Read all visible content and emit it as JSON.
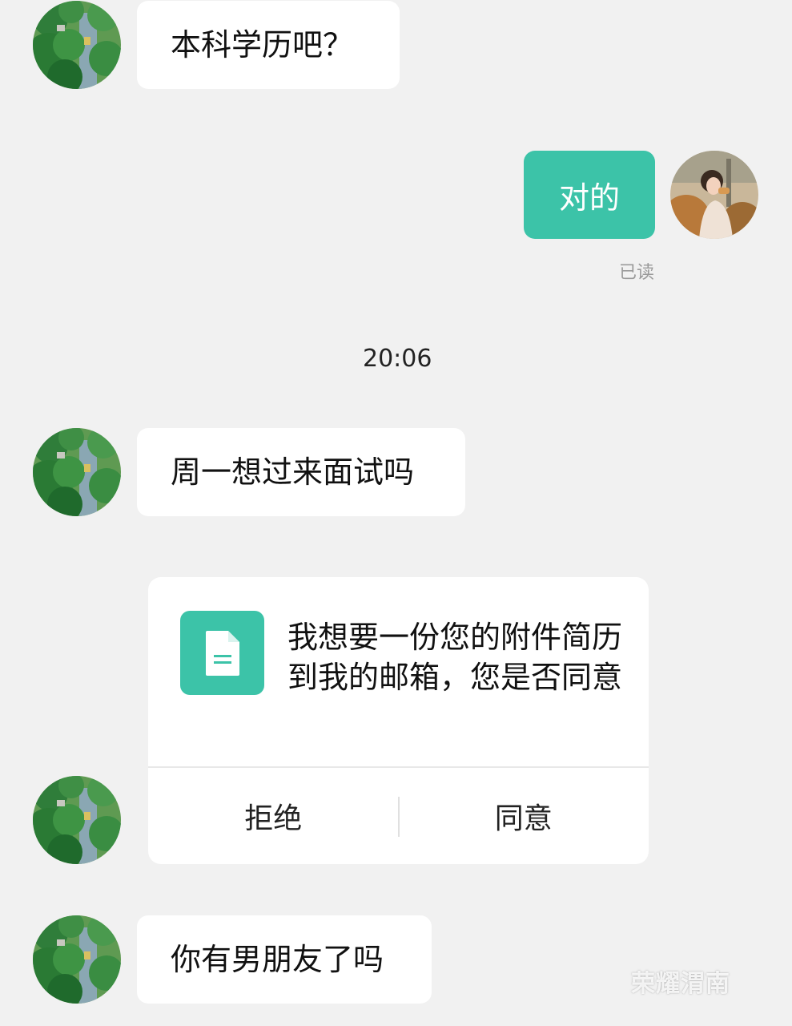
{
  "messages": [
    {
      "sender": "other",
      "text": "本科学历吧？"
    },
    {
      "sender": "me",
      "text": "对的",
      "status": "已读"
    },
    {
      "type": "timestamp",
      "text": "20:06"
    },
    {
      "sender": "other",
      "text": "周一想过来面试吗"
    },
    {
      "sender": "other",
      "type": "resume-request-card",
      "icon": "document-icon",
      "text": "我想要一份您的附件简历到我的邮箱，您是否同意",
      "actions": {
        "reject": "拒绝",
        "agree": "同意"
      }
    },
    {
      "sender": "other",
      "text": "你有男朋友了吗"
    }
  ],
  "watermark": {
    "text": "荣耀渭南"
  },
  "colors": {
    "background": "#f1f1f1",
    "my_bubble": "#3cc3a8",
    "other_bubble": "#ffffff",
    "card_icon": "#3cc3a8"
  }
}
